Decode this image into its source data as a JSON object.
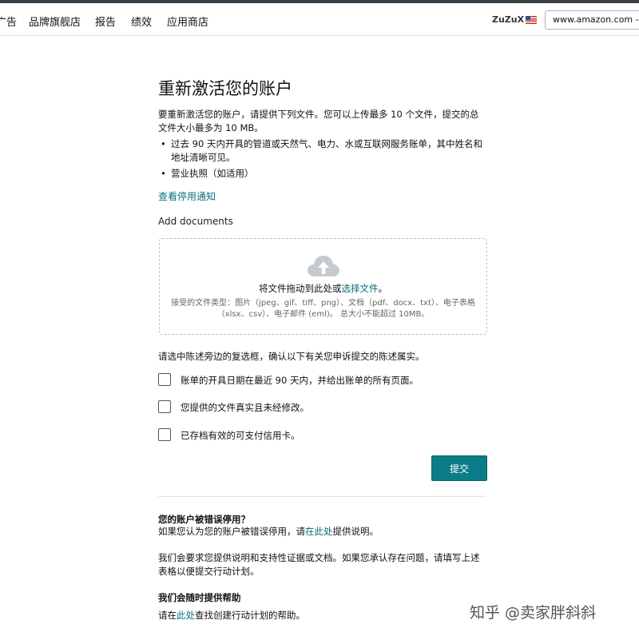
{
  "nav": {
    "items": [
      "广告",
      "品牌旗舰店",
      "报告",
      "绩效",
      "应用商店"
    ],
    "store_name": "ZuZuX",
    "marketplace": "www.amazon.com - ZuZuX",
    "flag_icon": "us-flag-icon"
  },
  "page": {
    "title": "重新激活您的账户",
    "intro": "要重新激活您的账户，请提供下列文件。您可以上传最多 10 个文件，提交的总文件大小最多为 10 MB。",
    "bullets": [
      "过去 90 天内开具的管道或天然气、电力、水或互联网服务账单，其中姓名和地址清晰可见。",
      "营业执照（如适用）"
    ],
    "notice_link": "查看停用通知",
    "add_documents": "Add documents"
  },
  "dropzone": {
    "icon": "cloud-upload-icon",
    "drop_prefix": "将文件拖动到此处或",
    "drop_link": "选择文件",
    "drop_suffix": "。",
    "accepted": "接受的文件类型：图片（jpeg、gif、tiff、png）、文档（pdf、docx、txt）、电子表格（xlsx、csv）、电子邮件 (eml)。 总大小不能超过 10MB。"
  },
  "confirm": {
    "text": "请选中陈述旁边的复选框，确认以下有关您申诉提交的陈述属实。",
    "checkboxes": [
      {
        "label": "账单的开具日期在最近 90 天内，并给出账单的所有页面。",
        "checked": false
      },
      {
        "label": "您提供的文件真实且未经修改。",
        "checked": false
      },
      {
        "label": "已存档有效的可支付信用卡。",
        "checked": false
      }
    ]
  },
  "submit_label": "提交",
  "help": {
    "heading1": "您的账户被错误停用？",
    "line1_prefix": "如果您认为您的账户被错误停用，请",
    "line1_link": "在此处",
    "line1_suffix": "提供说明。",
    "para2": "我们会要求您提供说明和支持性证据或文档。如果您承认存在问题，请填写上述表格以便提交行动计划。",
    "heading2": "我们会随时提供帮助",
    "line3_prefix": "请在",
    "line3_link": "此处",
    "line3_suffix": "查找创建行动计划的帮助。"
  },
  "watermark": "知乎 @卖家胖斜斜",
  "colors": {
    "accent": "#0b7d88",
    "link": "#0b6f7c",
    "top_border": "#3a4249"
  }
}
